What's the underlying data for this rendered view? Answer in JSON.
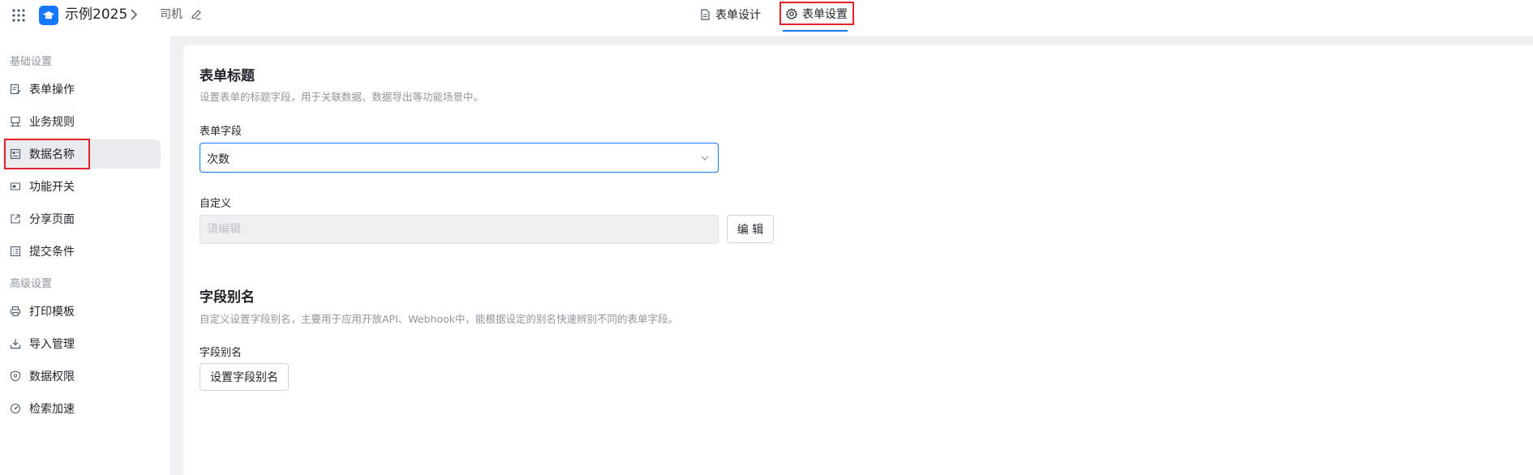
{
  "header": {
    "app_name": "示例2025",
    "form_name": "司机",
    "tabs": [
      {
        "label": "表单设计",
        "icon": "document-icon"
      },
      {
        "label": "表单设置",
        "icon": "gear-icon",
        "active": true
      }
    ]
  },
  "sidebar": {
    "groups": [
      {
        "title": "基础设置",
        "items": [
          {
            "label": "表单操作",
            "icon": "form-edit-icon"
          },
          {
            "label": "业务规则",
            "icon": "rules-icon"
          },
          {
            "label": "数据名称",
            "icon": "data-name-icon",
            "active": true
          },
          {
            "label": "功能开关",
            "icon": "toggle-icon"
          },
          {
            "label": "分享页面",
            "icon": "share-icon"
          },
          {
            "label": "提交条件",
            "icon": "checklist-icon"
          }
        ]
      },
      {
        "title": "高级设置",
        "items": [
          {
            "label": "打印模板",
            "icon": "printer-icon"
          },
          {
            "label": "导入管理",
            "icon": "import-icon"
          },
          {
            "label": "数据权限",
            "icon": "shield-icon"
          },
          {
            "label": "检索加速",
            "icon": "speed-icon"
          }
        ]
      }
    ]
  },
  "main": {
    "form_title_section": {
      "title": "表单标题",
      "description": "设置表单的标题字段，用于关联数据、数据导出等功能场景中。",
      "field_label": "表单字段",
      "field_value": "次数",
      "custom_label": "自定义",
      "custom_placeholder": "请编辑",
      "edit_button": "编 辑"
    },
    "alias_section": {
      "title": "字段别名",
      "description": "自定义设置字段别名，主要用于应用开放API、Webhook中，能根据设定的别名快速辨别不同的表单字段。",
      "field_label": "字段别名",
      "button": "设置字段别名"
    }
  },
  "colors": {
    "accent": "#1677ff",
    "highlight_box": "#e5212a",
    "active_item_bg": "#e9ebee"
  }
}
